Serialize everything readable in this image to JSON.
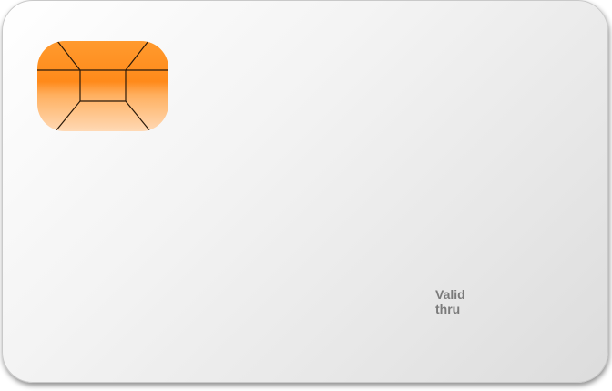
{
  "card": {
    "valid_thru_line1": "Valid",
    "valid_thru_line2": "thru"
  },
  "chip": {
    "icon": "emv-chip-icon",
    "color_top": "#ff8c1a",
    "color_bottom": "#ffd8b0"
  }
}
